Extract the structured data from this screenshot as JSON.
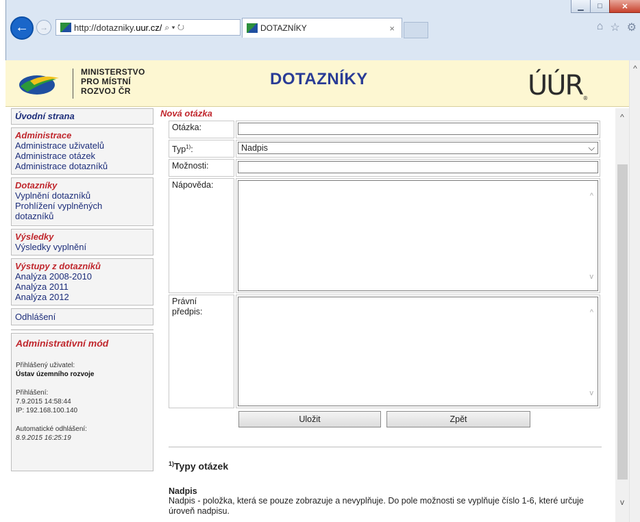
{
  "browser": {
    "window_controls": {
      "minimize": "▁",
      "maximize": "□",
      "close": "✕"
    },
    "address": {
      "url_host": "http://dotazniky.",
      "url_bold": "uur.cz/",
      "search": "⌕",
      "dropdown": "▾",
      "refresh": "↻"
    },
    "tab": {
      "label": "DOTAZNÍKY",
      "close": "×"
    },
    "icons": {
      "home": "⌂",
      "favorites": "☆",
      "settings": "⚙"
    }
  },
  "header": {
    "ministry_line1": "MINISTERSTVO",
    "ministry_line2": "PRO MÍSTNÍ",
    "ministry_line3": "ROZVOJ ČR",
    "title": "DOTAZNÍKY",
    "uur_logo": "ÚÚR",
    "uur_reg": "®"
  },
  "sidebar": {
    "home": "Úvodní strana",
    "admin_head": "Administrace",
    "admin_items": [
      "Administrace uživatelů",
      "Administrace otázek",
      "Administrace dotazníků"
    ],
    "dotazniky_head": "Dotazníky",
    "dotazniky_items": [
      "Vyplnění dotazníků",
      "Prohlížení vyplněných dotazníků"
    ],
    "vysledky_head": "Výsledky",
    "vysledky_items": [
      "Výsledky vyplnění"
    ],
    "vystupy_head": "Výstupy z dotazníků",
    "vystupy_items": [
      "Analýza 2008-2010",
      "Analýza 2011",
      "Analýza 2012"
    ],
    "logout": "Odhlášení",
    "admin_mode": {
      "title": "Administrativní mód",
      "user_label": "Přihlášený uživatel:",
      "user_value": "Ústav územního rozvoje",
      "login_label": "Přihlášení:",
      "login_value": "7.9.2015 14:58:44",
      "ip": "IP: 192.168.100.140",
      "auto_logout_label": "Automatické odhlášení:",
      "auto_logout_value": "8.9.2015 16:25:19"
    }
  },
  "form": {
    "title": "Nová otázka",
    "otazka_label": "Otázka:",
    "otazka_value": "",
    "typ_label": "Typ",
    "typ_sup": "1)",
    "typ_colon": ":",
    "typ_value": "Nadpis",
    "moznosti_label": "Možnosti:",
    "moznosti_value": "",
    "napoveda_label": "Nápověda:",
    "pravni_label_1": "Právní",
    "pravni_label_2": "předpis:",
    "save": "Uložit",
    "back": "Zpět"
  },
  "types": {
    "sup": "1)",
    "title": "Typy otázek",
    "nadpis_name": "Nadpis",
    "nadpis_desc": "Nadpis - položka, která se pouze zobrazuje a nevyplňuje. Do pole možnosti se vyplňuje číslo 1-6, které určuje úroveň nadpisu."
  },
  "colors": {
    "banner_bg": "#fdf7d2",
    "title_blue": "#2a3c96",
    "heading_red": "#c0272d",
    "link_blue": "#1c2d7a"
  }
}
